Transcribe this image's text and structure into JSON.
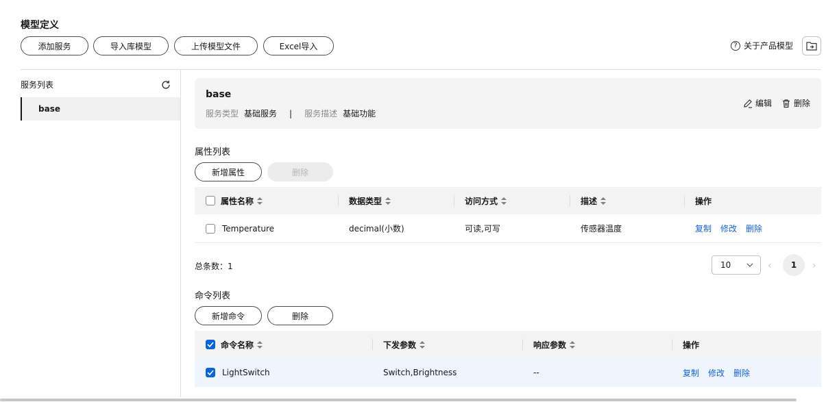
{
  "page": {
    "title": "模型定义"
  },
  "toolbar": {
    "add_service": "添加服务",
    "import_lib": "导入库模型",
    "upload_model": "上传模型文件",
    "excel_import": "Excel导入",
    "about_label": "关于产品模型"
  },
  "sidebar": {
    "title": "服务列表",
    "items": [
      {
        "label": "base",
        "selected": true
      }
    ]
  },
  "service": {
    "name": "base",
    "type_label": "服务类型",
    "type_value": "基础服务",
    "separator": "|",
    "desc_label": "服务描述",
    "desc_value": "基础功能",
    "edit_label": "编辑",
    "delete_label": "删除"
  },
  "properties": {
    "title": "属性列表",
    "add_label": "新增属性",
    "delete_label": "删除",
    "columns": [
      "属性名称",
      "数据类型",
      "访问方式",
      "描述",
      "操作"
    ],
    "rows": [
      {
        "name": "Temperature",
        "type": "decimal(小数)",
        "access": "可读,可写",
        "desc": "传感器温度",
        "checked": false
      }
    ],
    "actions": [
      "复制",
      "修改",
      "删除"
    ],
    "total_label": "总条数：1",
    "page_size": "10",
    "current_page": "1"
  },
  "commands": {
    "title": "命令列表",
    "add_label": "新增命令",
    "delete_label": "删除",
    "columns": [
      "命令名称",
      "下发参数",
      "响应参数",
      "操作"
    ],
    "rows": [
      {
        "name": "LightSwitch",
        "params": "Switch,Brightness",
        "response": "--",
        "checked": true
      }
    ],
    "actions": [
      "复制",
      "修改",
      "删除"
    ],
    "header_checked": true
  },
  "colors": {
    "accent": "#0a64d6",
    "link": "#1764d2",
    "selected_row": "#eef5fd"
  }
}
